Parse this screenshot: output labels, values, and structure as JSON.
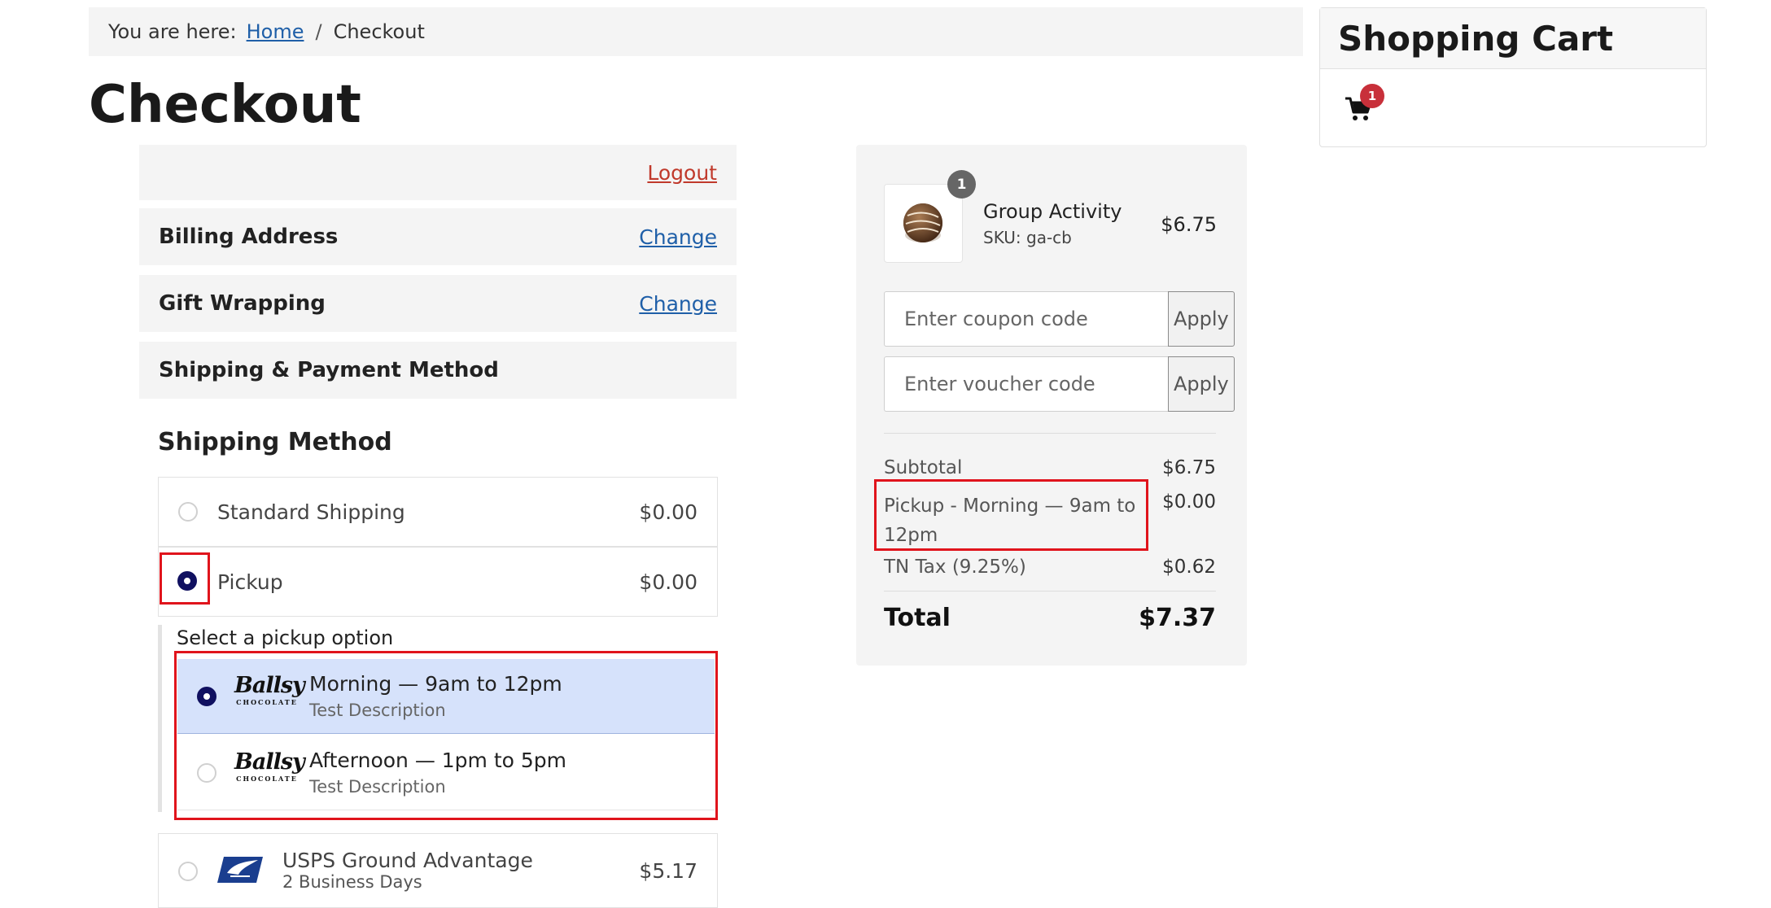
{
  "breadcrumb": {
    "prefix": "You are here:",
    "home": "Home",
    "separator": "/",
    "current": "Checkout"
  },
  "page_title": "Checkout",
  "steps": {
    "logout": "Logout",
    "billing": {
      "title": "Billing Address",
      "action": "Change"
    },
    "gift": {
      "title": "Gift Wrapping",
      "action": "Change"
    },
    "shipping_payment": {
      "title": "Shipping & Payment Method"
    }
  },
  "shipping": {
    "title": "Shipping Method",
    "options": [
      {
        "label": "Standard Shipping",
        "price": "$0.00",
        "selected": false
      },
      {
        "label": "Pickup",
        "price": "$0.00",
        "selected": true
      },
      {
        "label": "USPS Ground Advantage",
        "sublabel": "2 Business Days",
        "price": "$5.17",
        "selected": false
      }
    ],
    "pickup": {
      "label": "Select a pickup option",
      "logo": {
        "name": "Ballsy",
        "sub": "CHOCOLATE"
      },
      "items": [
        {
          "title": "Morning — 9am to 12pm",
          "desc": "Test Description",
          "selected": true
        },
        {
          "title": "Afternoon — 1pm to 5pm",
          "desc": "Test Description",
          "selected": false
        }
      ]
    }
  },
  "summary": {
    "item": {
      "quantity": "1",
      "name": "Group Activity",
      "sku": "SKU: ga-cb",
      "price": "$6.75"
    },
    "coupon": {
      "placeholder": "Enter coupon code",
      "button": "Apply"
    },
    "voucher": {
      "placeholder": "Enter voucher code",
      "button": "Apply"
    },
    "lines": [
      {
        "label": "Subtotal",
        "value": "$6.75"
      },
      {
        "label": "Pickup - Morning — 9am to 12pm",
        "value": "$0.00"
      },
      {
        "label": "TN Tax (9.25%)",
        "value": "$0.62"
      }
    ],
    "total": {
      "label": "Total",
      "value": "$7.37"
    }
  },
  "cart": {
    "title": "Shopping Cart",
    "count": "1"
  },
  "colors": {
    "accent": "#101060",
    "highlight": "#d6e2fb",
    "annotation": "#e0141c",
    "badge": "#c8303a",
    "link": "#1f5fa8"
  }
}
